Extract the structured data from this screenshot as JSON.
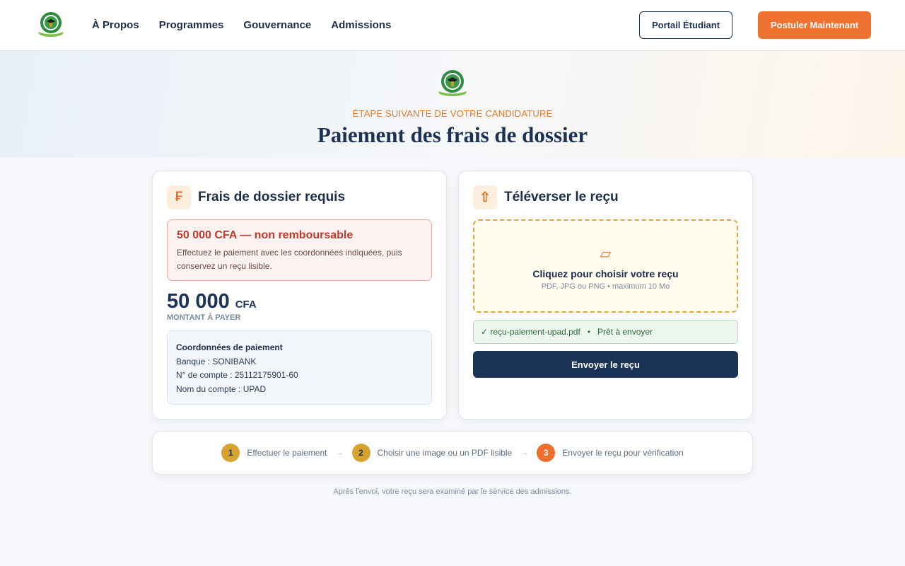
{
  "nav": {
    "items": [
      {
        "label": "À Propos"
      },
      {
        "label": "Programmes"
      },
      {
        "label": "Gouvernance"
      },
      {
        "label": "Admissions"
      }
    ],
    "portal_label": "Portail Étudiant",
    "apply_label": "Postuler Maintenant"
  },
  "hero": {
    "kicker": "ÉTAPE SUIVANTE DE VOTRE CANDIDATURE",
    "title": "Paiement des frais de dossier"
  },
  "fees_card": {
    "icon": "franc-icon",
    "icon_glyph": "₣",
    "title": "Frais de dossier requis",
    "alert_title": "50 000 CFA — non remboursable",
    "alert_text": "Effectuez le paiement avec les coordonnées indiquées, puis conservez un reçu lisible.",
    "amount": "50 000",
    "currency": "CFA",
    "amount_label": "MONTANT À PAYER",
    "payment": {
      "title": "Coordonnées de paiement",
      "bank": "Banque : SONIBANK",
      "account_number": "N° de compte : 25112175901-60",
      "account_name": "Nom du compte : UPAD"
    }
  },
  "upload_card": {
    "icon": "upload-arrow-icon",
    "icon_glyph": "⇧",
    "title": "Téléverser le reçu",
    "dropzone_icon_glyph": "▱",
    "dropzone_title": "Cliquez pour choisir votre reçu",
    "dropzone_sub": "PDF, JPG ou PNG • maximum 10 Mo",
    "file_name": "✓ reçu-paiement-upad.pdf",
    "file_sep": "•",
    "file_status": "Prêt à envoyer",
    "send_label": "Envoyer le reçu"
  },
  "steps": [
    {
      "num": "1",
      "label": "Effectuer le paiement"
    },
    {
      "num": "2",
      "label": "Choisir une image ou un PDF lisible"
    },
    {
      "num": "3",
      "label": "Envoyer le reçu pour vérification"
    }
  ],
  "step_arrow": "→",
  "footnote": "Après l'envoi, votre reçu sera examiné par le service des admissions.",
  "colors": {
    "accent": "#f07230",
    "navy": "#1b3354",
    "gold": "#d6a232",
    "alert_red": "#c0392b"
  }
}
